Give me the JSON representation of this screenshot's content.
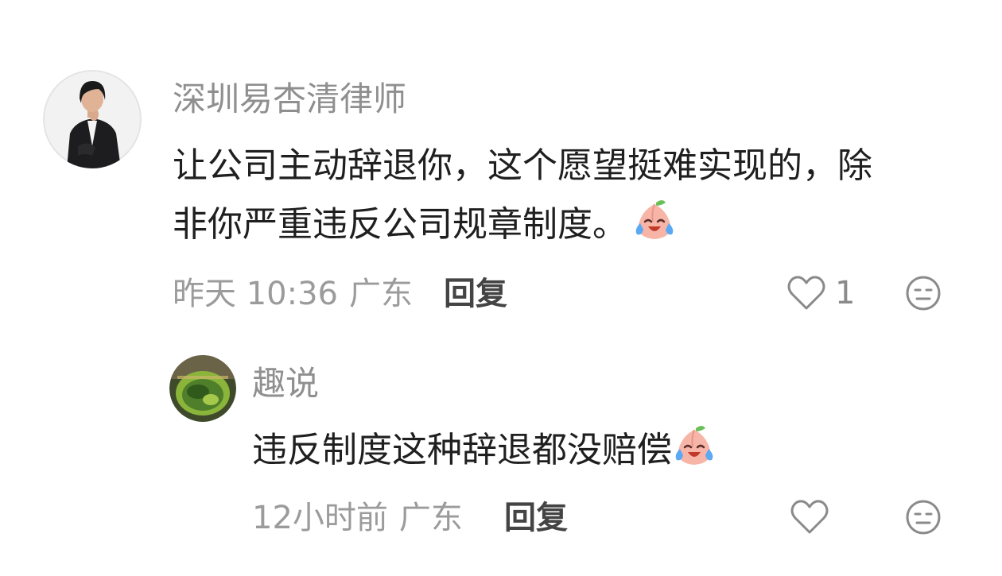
{
  "comments": [
    {
      "username": "深圳易杏清律师",
      "text_line1": "让公司主动辞退你，这个愿望挺难实现的，除",
      "text_line2": "非你严重违反公司规章制度。",
      "emoji": "crying-laughing-peach-emoji",
      "time": "昨天 10:36",
      "location": "广东",
      "reply_label": "回复",
      "like_count": "1",
      "avatar": "lawyer-portrait-avatar"
    },
    {
      "username": "趣说",
      "text": "违反制度这种辞退都没赔偿",
      "emoji": "crying-laughing-peach-emoji",
      "time": "12小时前",
      "location": "广东",
      "reply_label": "回复",
      "like_count": "",
      "avatar": "green-tea-glass-avatar"
    }
  ],
  "icons": {
    "like": "heart-outline-icon",
    "dislike": "meh-face-icon"
  },
  "colors": {
    "username": "#8f8f8f",
    "text": "#1f1f1f",
    "meta": "#9b9b9b",
    "reply": "#444444",
    "icon": "#8a8a8a"
  }
}
